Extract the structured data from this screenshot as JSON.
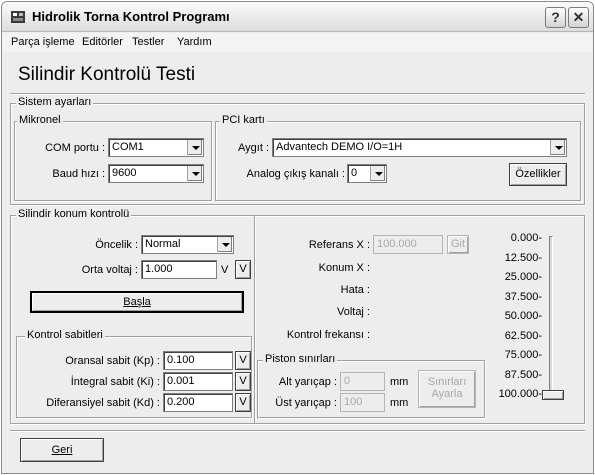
{
  "window": {
    "title": "Hidrolik Torna Kontrol Programı",
    "help_glyph": "?",
    "close_glyph": "✕"
  },
  "menu": [
    {
      "label": "Parça işleme"
    },
    {
      "label": "Editörler"
    },
    {
      "label": "Testler"
    },
    {
      "label": "Yardım"
    }
  ],
  "page_title": "Silindir Kontrolü Testi",
  "system": {
    "label": "Sistem ayarları",
    "mikronel": {
      "label": "Mikronel",
      "com_label": "COM portu :",
      "com_value": "COM1",
      "baud_label": "Baud hızı :",
      "baud_value": "9600"
    },
    "pci": {
      "label": "PCI kartı",
      "device_label": "Aygıt :",
      "device_value": "Advantech DEMO I/O=1H",
      "analog_label": "Analog çıkış kanalı :",
      "analog_value": "0",
      "properties_button": "Özellikler"
    }
  },
  "position": {
    "label": "Silindir konum kontrolü",
    "priority_label": "Öncelik :",
    "priority_value": "Normal",
    "voltage_label": "Orta voltaj :",
    "voltage_value": "1.000",
    "voltage_unit": "V",
    "voltage_btn": "V",
    "start_button": "Başla",
    "ref_label": "Referans X :",
    "ref_value": "100.000",
    "go_button": "Git",
    "konum_label": "Konum X :",
    "hata_label": "Hata :",
    "voltaj_label": "Voltaj :",
    "freq_label": "Kontrol frekansı :",
    "slider_value": 100,
    "scale": [
      "0.000-",
      "12.500-",
      "25.000-",
      "37.500-",
      "50.000-",
      "62.500-",
      "75.000-",
      "87.500-",
      "100.000-"
    ]
  },
  "constants": {
    "label": "Kontrol sabitleri",
    "kp_label": "Oransal sabit (Kp) :",
    "kp_value": "0.100",
    "ki_label": "İntegral sabit (Ki) :",
    "ki_value": "0.001",
    "kd_label": "Diferansiyel sabit (Kd) :",
    "kd_value": "0.200",
    "v_btn": "V"
  },
  "piston": {
    "label": "Piston sınırları",
    "lower_label": "Alt yarıçap :",
    "lower_value": "0",
    "lower_unit": "mm",
    "upper_label": "Üst yarıçap :",
    "upper_value": "100",
    "upper_unit": "mm",
    "set_button_line1": "Sınırları",
    "set_button_line2": "Ayarla"
  },
  "back_button": "Geri"
}
